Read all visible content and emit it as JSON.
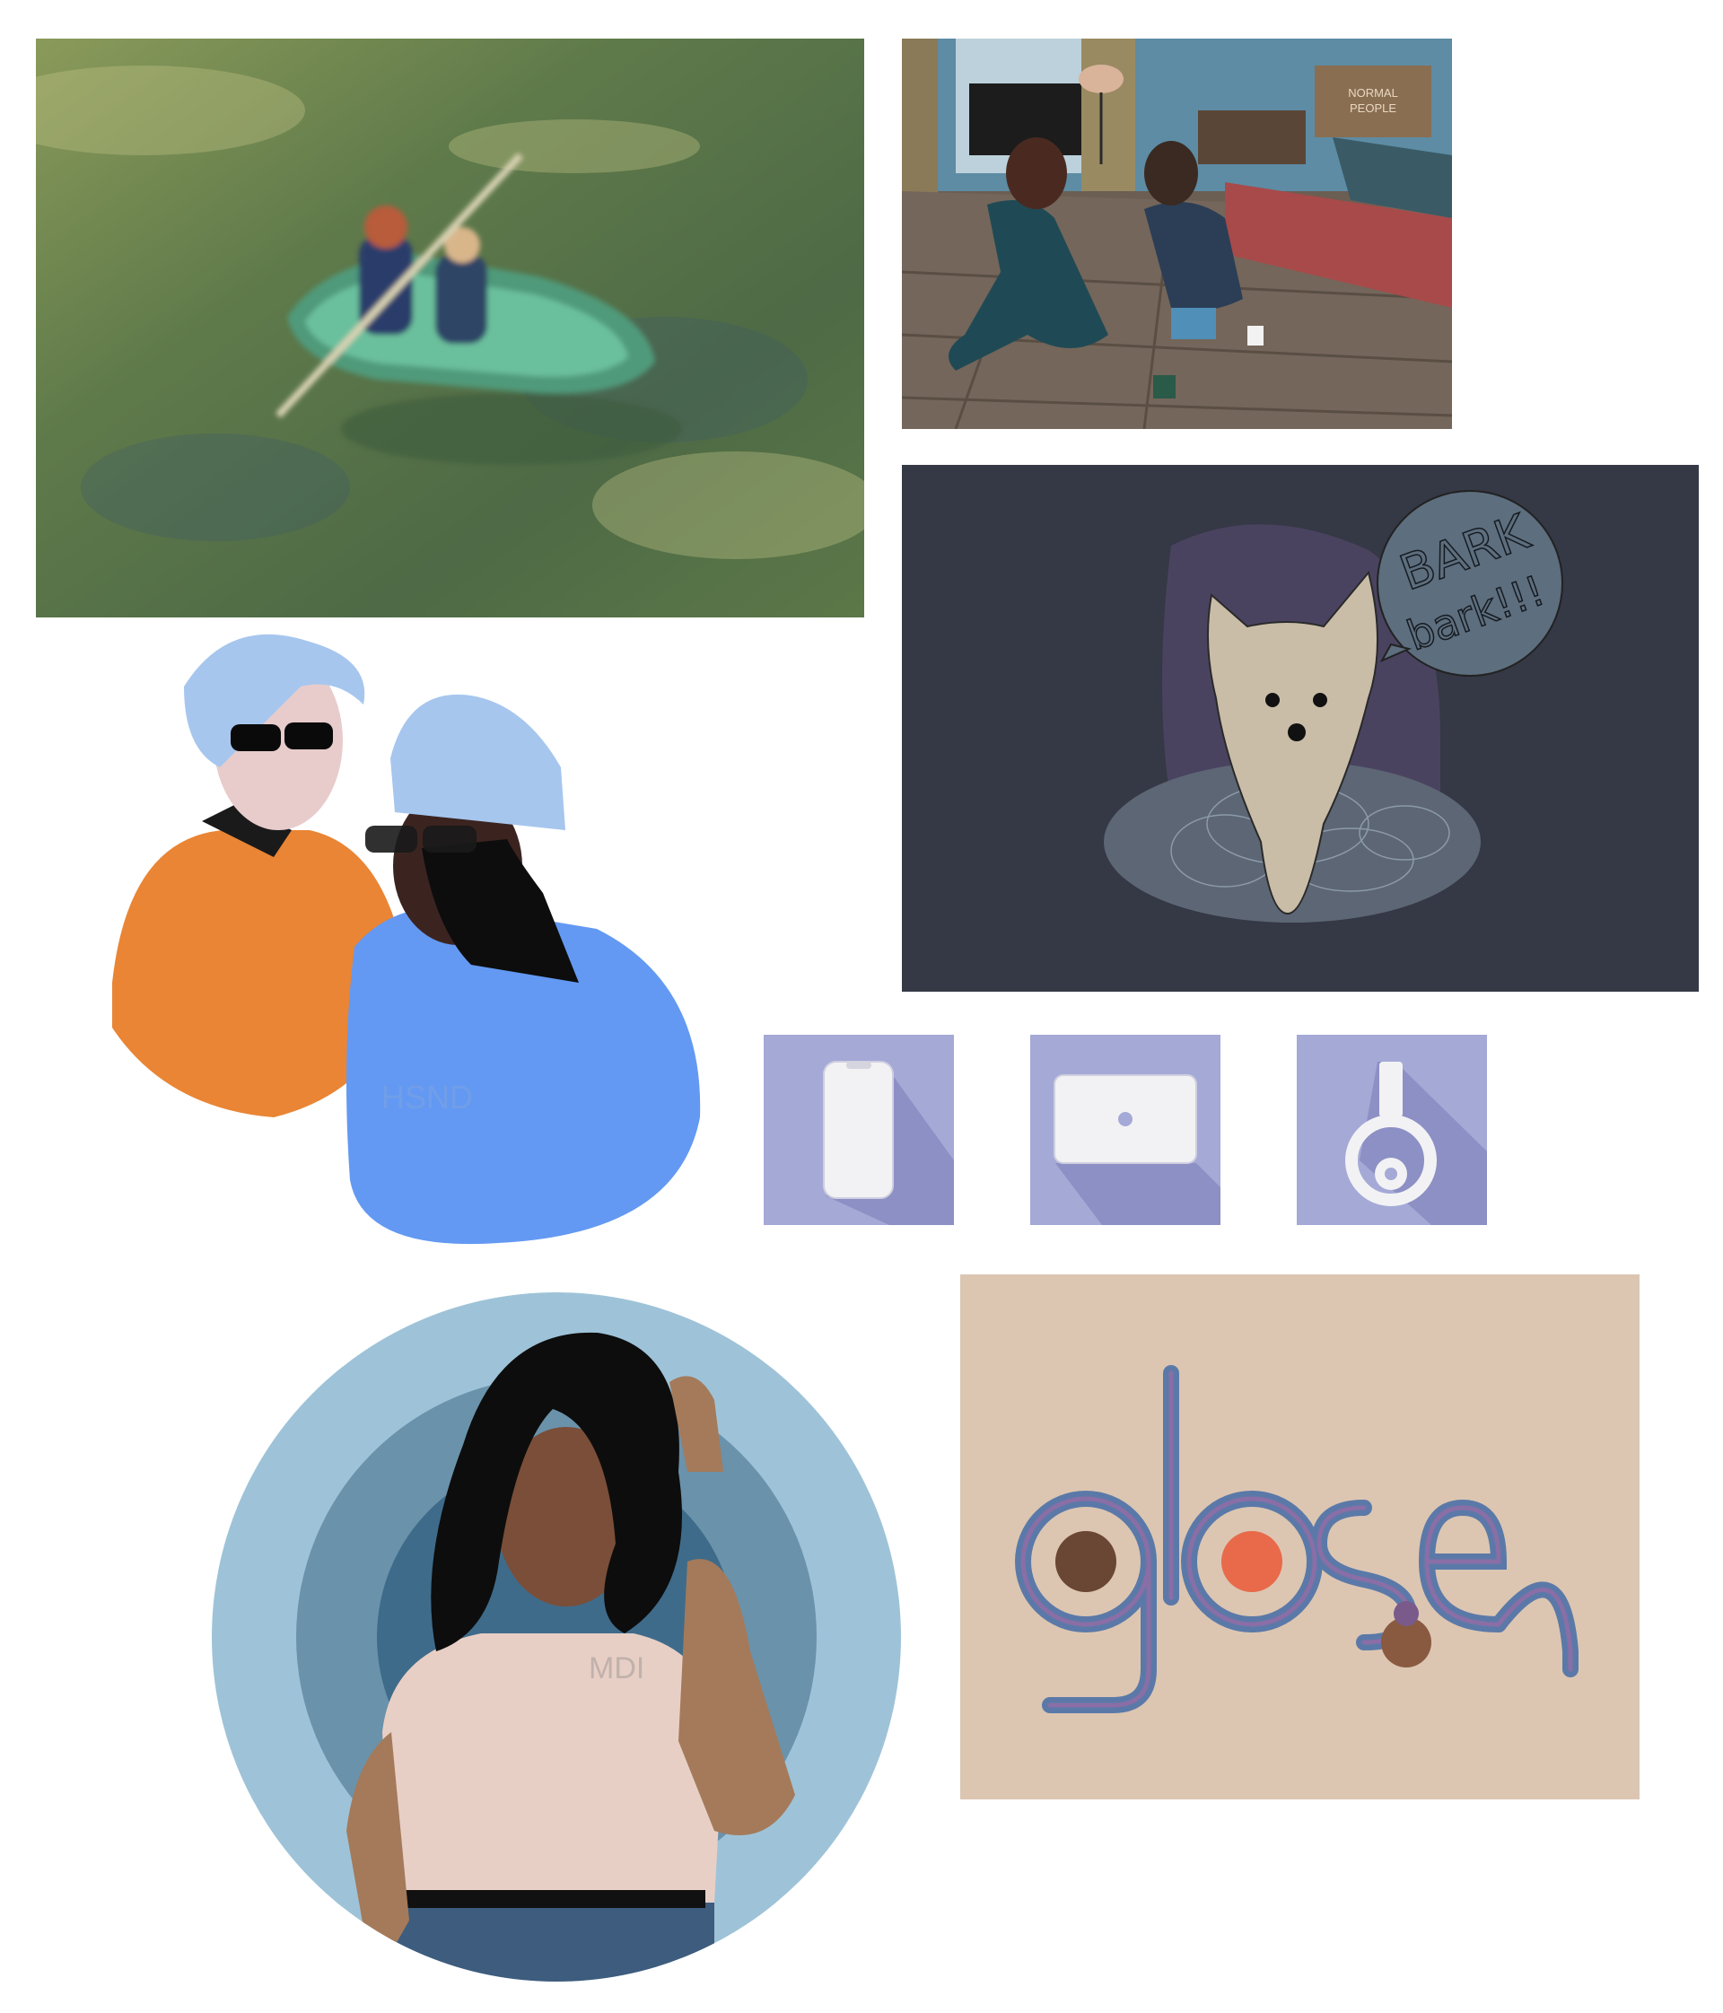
{
  "gallery": {
    "boat": {
      "kind": "illustration"
    },
    "room": {
      "box_text": "NORMAL\nPEOPLE",
      "box_line1": "NORMAL",
      "box_line2": "PEOPLE"
    },
    "dog": {
      "speech_line1": "BARK",
      "speech_line2": "bark!!!"
    },
    "couple": {
      "watermark": "HSND"
    },
    "icons": [
      {
        "name": "phone",
        "color": "#a5a9d6"
      },
      {
        "name": "laptop",
        "color": "#a5a9d6"
      },
      {
        "name": "headphones",
        "color": "#a5a9d6"
      }
    ],
    "portrait": {
      "watermark": "MDI"
    },
    "wordmark": {
      "text": "glose"
    }
  },
  "colors": {
    "boat_bg": "#5f7a4a",
    "room_bg": "#6b5e52",
    "dog_bg": "#353845",
    "icon_bg": "#a5a9d6",
    "portrait_ring": "#9ec3d8",
    "wordmark_bg": "#dcc6b2"
  }
}
